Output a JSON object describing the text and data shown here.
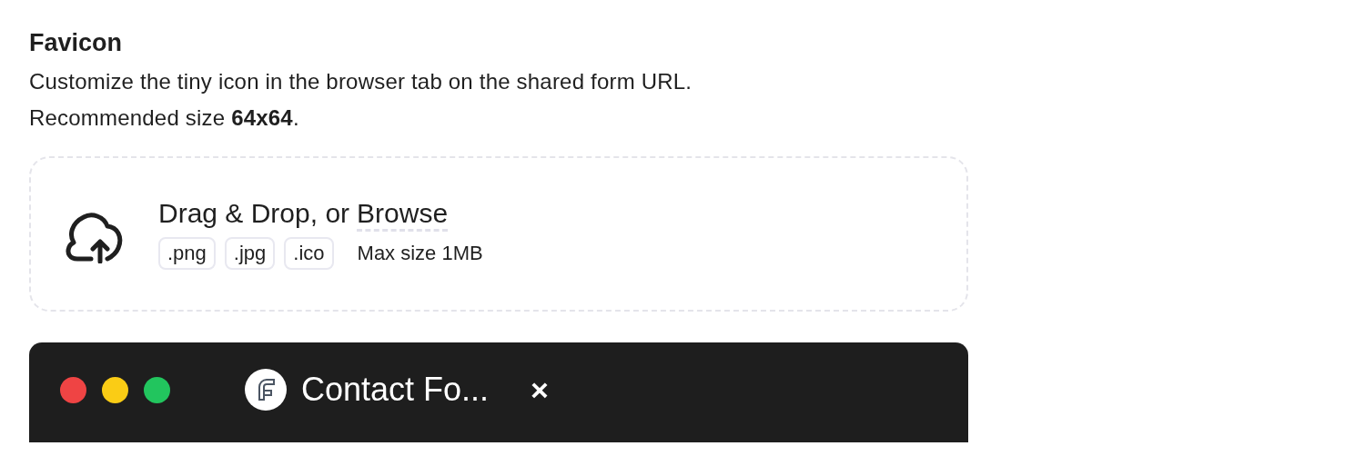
{
  "section": {
    "title": "Favicon",
    "description": [
      "Customize the tiny icon in the browser tab on the shared form URL.",
      "Recommended size **64x64**."
    ]
  },
  "dropzone": {
    "prompt": "Drag & Drop, or",
    "link": "Browse",
    "formats": [
      ".png",
      ".jpg",
      ".ico"
    ],
    "max_size": "Max size 1MB"
  },
  "browser_preview": {
    "window_controls": [
      {
        "color": "#ef4444"
      },
      {
        "color": "#facc15"
      },
      {
        "color": "#22c55e"
      }
    ],
    "tab": {
      "title": "Contact Fo...",
      "close": "×"
    }
  }
}
